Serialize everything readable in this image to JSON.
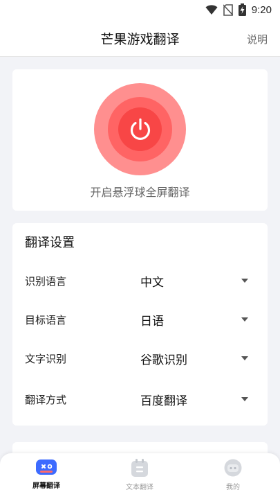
{
  "status_bar": {
    "time": "9:20",
    "icons": [
      "wifi-icon",
      "no-sim-icon",
      "battery-charging-icon"
    ]
  },
  "header": {
    "title": "芒果游戏翻译",
    "help_label": "说明"
  },
  "power": {
    "label": "开启悬浮球全屏翻译",
    "icon": "power-icon",
    "colors": {
      "outer": "#ff8f8f",
      "middle": "#ff6464",
      "inner": "#f84646"
    }
  },
  "settings": {
    "title": "翻译设置",
    "rows": [
      {
        "label": "识别语言",
        "value": "中文"
      },
      {
        "label": "目标语言",
        "value": "日语"
      },
      {
        "label": "文字识别",
        "value": "谷歌识别"
      },
      {
        "label": "翻译方式",
        "value": "百度翻译"
      }
    ]
  },
  "bottom_nav": {
    "items": [
      {
        "label": "屏幕翻译",
        "icon": "gamepad-icon",
        "active": true
      },
      {
        "label": "文本翻译",
        "icon": "document-icon",
        "active": false
      },
      {
        "label": "我的",
        "icon": "robot-avatar-icon",
        "active": false
      }
    ],
    "accent": "#3d6bff"
  }
}
